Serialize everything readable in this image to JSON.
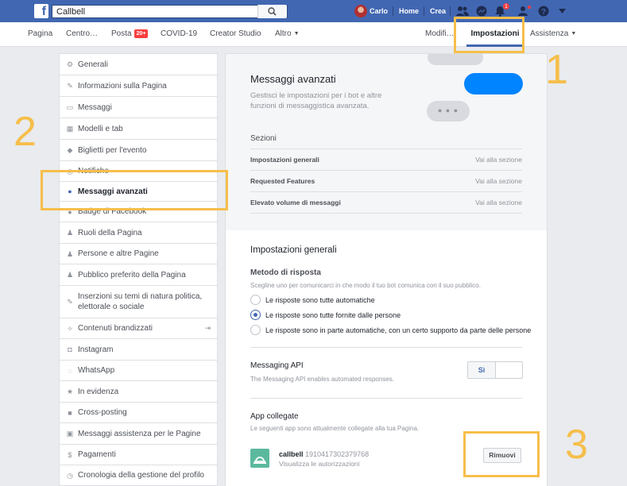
{
  "topbar": {
    "search_value": "Callbell",
    "user_name": "Carlo",
    "home": "Home",
    "create": "Crea",
    "notification_count": "1"
  },
  "subnav": {
    "items": [
      "Pagina",
      "Centro…",
      "Posta",
      "COVID-19",
      "Creator Studio",
      "Altro"
    ],
    "posta_badge": "20+",
    "right": [
      "Modifi…",
      "Impostazioni",
      "Assistenza"
    ]
  },
  "sidebar": {
    "items": [
      {
        "label": "Generali",
        "icon": "gear-icon"
      },
      {
        "label": "Informazioni sulla Pagina",
        "icon": "pencil-icon"
      },
      {
        "label": "Messaggi",
        "icon": "message-icon"
      },
      {
        "label": "Modelli e tab",
        "icon": "grid-icon"
      },
      {
        "label": "Biglietti per l'evento",
        "icon": "ticket-icon"
      },
      {
        "label": "Notifiche",
        "icon": "globe-icon"
      },
      {
        "label": "Messaggi avanzati",
        "icon": "messenger-icon"
      },
      {
        "label": "Badge di Facebook",
        "icon": "badge-icon"
      },
      {
        "label": "Ruoli della Pagina",
        "icon": "person-icon"
      },
      {
        "label": "Persone e altre Pagine",
        "icon": "people-icon"
      },
      {
        "label": "Pubblico preferito della Pagina",
        "icon": "audience-icon"
      },
      {
        "label": "Inserzioni su temi di natura politica, elettorale o sociale",
        "icon": "wrench-icon"
      },
      {
        "label": "Contenuti brandizzati",
        "icon": "handshake-icon"
      },
      {
        "label": "Instagram",
        "icon": "instagram-icon"
      },
      {
        "label": "WhatsApp",
        "icon": "whatsapp-icon"
      },
      {
        "label": "In evidenza",
        "icon": "star-icon"
      },
      {
        "label": "Cross-posting",
        "icon": "video-icon"
      },
      {
        "label": "Messaggi assistenza per le Pagine",
        "icon": "inbox-icon"
      },
      {
        "label": "Pagamenti",
        "icon": "dollar-icon"
      },
      {
        "label": "Cronologia della gestione del profilo",
        "icon": "history-icon"
      }
    ]
  },
  "main": {
    "hero_title": "Messaggi avanzati",
    "hero_desc": "Gestisci le impostazioni per i bot e altre funzioni di messaggistica avanzata.",
    "sections_label": "Sezioni",
    "sections": [
      {
        "name": "Impostazioni generali",
        "link": "Vai alla sezione"
      },
      {
        "name": "Requested Features",
        "link": "Vai alla sezione"
      },
      {
        "name": "Elevato volume di messaggi",
        "link": "Vai alla sezione"
      }
    ],
    "general_title": "Impostazioni generali",
    "response_label": "Metodo di risposta",
    "response_desc": "Scegline uno per comunicarci in che modo il tuo bot comunica con il suo pubblico.",
    "radios": [
      {
        "label": "Le risposte sono tutte automatiche",
        "selected": false
      },
      {
        "label": "Le risposte sono tutte fornite dalle persone",
        "selected": true
      },
      {
        "label": "Le risposte sono in parte automatiche, con un certo supporto da parte delle persone",
        "selected": false
      }
    ],
    "api_label": "Messaging API",
    "api_desc": "The Messaging API enables automated responses.",
    "api_toggle": "Sì",
    "apps_label": "App collegate",
    "apps_desc": "Le seguenti app sono attualmente collegate alla tua Pagina.",
    "app_name": "callbell",
    "app_id": "1910417302379768",
    "app_link": "Visualizza le autorizzazioni",
    "remove_button": "Rimuovi"
  },
  "annotations": [
    "1",
    "2",
    "3"
  ],
  "colors": {
    "facebook_blue": "#4267b2",
    "highlight": "#f6be4b",
    "messenger_blue": "#0084ff"
  }
}
